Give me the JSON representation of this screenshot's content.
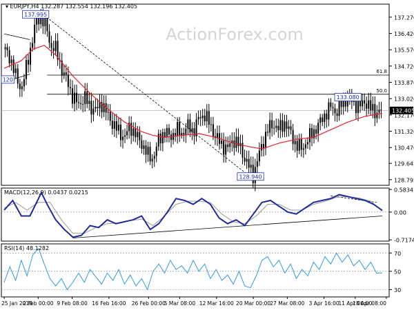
{
  "watermark": "ActionForex.com",
  "chart_data": [
    {
      "type": "candlestick",
      "panel": "price",
      "symbol_label": "EURJPY,H4",
      "ohlc_label": "132.287 132.554 132.196 132.405",
      "last_price": 132.405,
      "ylim": [
        128.5,
        137.95
      ],
      "y_ticks": [
        128.795,
        129.645,
        130.47,
        131.32,
        132.17,
        133.02,
        133.87,
        134.72,
        135.57,
        136.42,
        137.27
      ],
      "y_tick_labels": [
        "128.795",
        "129.645",
        "130.470",
        "131.320",
        "132.170",
        "133.020",
        "133.870",
        "134.720",
        "135.570",
        "136.420",
        "137.270"
      ],
      "x_range": [
        0,
        132
      ],
      "x_ticks": [
        0,
        12,
        25,
        38,
        52,
        63,
        76,
        89,
        101,
        114,
        125
      ],
      "x_tick_labels": [
        "25 Jan 2018",
        "2 Feb 00:00",
        "9 Feb 08:00",
        "16 Feb 16:00",
        "26 Feb 00:00",
        "5 Mar 08:00",
        "12 Mar 16:00",
        "20 Mar 00:00",
        "27 Mar 08:00",
        "3 Apr 16:00",
        "11 Apr 00:00",
        "18 Apr 08:00"
      ],
      "x_tick_positions": [
        1,
        13,
        25,
        38,
        52,
        63,
        76,
        89,
        101,
        114,
        125,
        136
      ],
      "close_path": [
        [
          0,
          135.6
        ],
        [
          2,
          135.2
        ],
        [
          4,
          134.2
        ],
        [
          6,
          133.5
        ],
        [
          8,
          134.8
        ],
        [
          10,
          136.2
        ],
        [
          11,
          137.0
        ],
        [
          13,
          137.3
        ],
        [
          15,
          136.6
        ],
        [
          16,
          135.8
        ],
        [
          18,
          135.6
        ],
        [
          20,
          134.6
        ],
        [
          22,
          133.9
        ],
        [
          24,
          133.1
        ],
        [
          26,
          132.7
        ],
        [
          28,
          133.1
        ],
        [
          30,
          132.6
        ],
        [
          32,
          132.4
        ],
        [
          34,
          132.8
        ],
        [
          36,
          132.2
        ],
        [
          38,
          131.7
        ],
        [
          40,
          131.3
        ],
        [
          42,
          131.0
        ],
        [
          44,
          131.6
        ],
        [
          46,
          131.1
        ],
        [
          48,
          130.7
        ],
        [
          50,
          130.1
        ],
        [
          52,
          129.9
        ],
        [
          54,
          130.9
        ],
        [
          56,
          131.3
        ],
        [
          58,
          131.0
        ],
        [
          60,
          131.4
        ],
        [
          62,
          131.2
        ],
        [
          64,
          131.6
        ],
        [
          66,
          131.3
        ],
        [
          68,
          132.0
        ],
        [
          70,
          132.2
        ],
        [
          72,
          131.6
        ],
        [
          74,
          131.0
        ],
        [
          76,
          130.6
        ],
        [
          78,
          130.4
        ],
        [
          80,
          130.9
        ],
        [
          82,
          130.6
        ],
        [
          84,
          129.9
        ],
        [
          86,
          129.3
        ],
        [
          87,
          129.0
        ],
        [
          88,
          129.6
        ],
        [
          90,
          130.6
        ],
        [
          92,
          131.4
        ],
        [
          94,
          131.7
        ],
        [
          96,
          131.4
        ],
        [
          98,
          131.8
        ],
        [
          100,
          131.2
        ],
        [
          102,
          130.6
        ],
        [
          104,
          130.4
        ],
        [
          106,
          130.9
        ],
        [
          108,
          131.3
        ],
        [
          110,
          131.7
        ],
        [
          112,
          132.2
        ],
        [
          114,
          132.6
        ],
        [
          116,
          132.3
        ],
        [
          118,
          132.8
        ],
        [
          120,
          133.1
        ],
        [
          122,
          132.8
        ],
        [
          124,
          132.6
        ],
        [
          126,
          132.9
        ],
        [
          128,
          132.5
        ],
        [
          130,
          132.3
        ],
        [
          132,
          132.405
        ]
      ],
      "ma_path": [
        [
          0,
          134.6
        ],
        [
          6,
          135.0
        ],
        [
          10,
          135.6
        ],
        [
          14,
          135.8
        ],
        [
          18,
          135.3
        ],
        [
          24,
          134.2
        ],
        [
          30,
          133.3
        ],
        [
          36,
          132.5
        ],
        [
          42,
          131.8
        ],
        [
          48,
          131.3
        ],
        [
          52,
          131.1
        ],
        [
          56,
          131.0
        ],
        [
          62,
          131.1
        ],
        [
          68,
          131.2
        ],
        [
          74,
          131.0
        ],
        [
          80,
          130.7
        ],
        [
          86,
          130.5
        ],
        [
          90,
          130.4
        ],
        [
          96,
          130.7
        ],
        [
          102,
          130.9
        ],
        [
          108,
          131.0
        ],
        [
          114,
          131.4
        ],
        [
          120,
          131.8
        ],
        [
          126,
          132.1
        ],
        [
          132,
          132.25
        ]
      ],
      "annotations": [
        {
          "label": "137.995",
          "x": 11,
          "y": 137.4
        },
        {
          "label": "128.940",
          "x": 86,
          "y": 128.94
        },
        {
          "label": "133.080",
          "x": 120,
          "y": 133.08
        },
        {
          "label": "120",
          "x": 0,
          "y": 134.0
        }
      ],
      "levels": [
        {
          "label": "61.8",
          "y": 134.25,
          "x_start": 15
        },
        {
          "label": "50.0",
          "y": 133.25,
          "x_start": 15
        }
      ],
      "trendlines": [
        {
          "from": [
            12,
            137.6
          ],
          "to": [
            86,
            128.94
          ],
          "style": "dashed"
        },
        {
          "from": [
            0,
            136.4
          ],
          "to": [
            9,
            136.1
          ],
          "style": "solid"
        },
        {
          "from": [
            0,
            133.9
          ],
          "to": [
            9,
            134.3
          ],
          "style": "solid"
        }
      ]
    },
    {
      "type": "line",
      "panel": "macd",
      "label": "MACD(12,26,9) 0.0437 0.0215",
      "ylim": [
        -0.75,
        0.62
      ],
      "y_ticks": [
        0.5834,
        0.0,
        -0.7174
      ],
      "y_tick_labels": [
        "0.5834",
        "0.00",
        "-0.7174"
      ],
      "series": [
        {
          "values": [
            [
              0,
              0.05
            ],
            [
              3,
              0.3
            ],
            [
              6,
              -0.1
            ],
            [
              9,
              -0.1
            ],
            [
              12,
              0.35
            ],
            [
              13,
              0.5
            ],
            [
              15,
              0.2
            ],
            [
              18,
              -0.2
            ],
            [
              21,
              -0.45
            ],
            [
              24,
              -0.65
            ],
            [
              27,
              -0.6
            ],
            [
              30,
              -0.35
            ],
            [
              33,
              -0.4
            ],
            [
              36,
              -0.2
            ],
            [
              39,
              -0.3
            ],
            [
              42,
              -0.25
            ],
            [
              45,
              -0.2
            ],
            [
              48,
              -0.1
            ],
            [
              51,
              -0.45
            ],
            [
              54,
              -0.3
            ],
            [
              57,
              0.0
            ],
            [
              60,
              0.35
            ],
            [
              63,
              0.3
            ],
            [
              66,
              0.2
            ],
            [
              69,
              0.35
            ],
            [
              72,
              0.2
            ],
            [
              75,
              -0.15
            ],
            [
              78,
              -0.3
            ],
            [
              81,
              -0.2
            ],
            [
              84,
              -0.35
            ],
            [
              87,
              -0.05
            ],
            [
              90,
              0.25
            ],
            [
              93,
              0.3
            ],
            [
              96,
              0.15
            ],
            [
              99,
              0.0
            ],
            [
              102,
              -0.05
            ],
            [
              105,
              0.1
            ],
            [
              108,
              0.25
            ],
            [
              111,
              0.3
            ],
            [
              114,
              0.35
            ],
            [
              117,
              0.45
            ],
            [
              120,
              0.4
            ],
            [
              123,
              0.35
            ],
            [
              126,
              0.3
            ],
            [
              129,
              0.2
            ],
            [
              132,
              0.0437
            ]
          ]
        },
        {
          "values": [
            [
              0,
              0.1
            ],
            [
              4,
              0.25
            ],
            [
              8,
              0.05
            ],
            [
              12,
              0.25
            ],
            [
              16,
              0.25
            ],
            [
              20,
              -0.2
            ],
            [
              24,
              -0.55
            ],
            [
              28,
              -0.55
            ],
            [
              32,
              -0.4
            ],
            [
              36,
              -0.3
            ],
            [
              40,
              -0.28
            ],
            [
              44,
              -0.22
            ],
            [
              48,
              -0.18
            ],
            [
              52,
              -0.35
            ],
            [
              56,
              -0.1
            ],
            [
              60,
              0.2
            ],
            [
              64,
              0.28
            ],
            [
              68,
              0.28
            ],
            [
              72,
              0.25
            ],
            [
              76,
              -0.05
            ],
            [
              80,
              -0.25
            ],
            [
              84,
              -0.3
            ],
            [
              88,
              -0.1
            ],
            [
              92,
              0.2
            ],
            [
              96,
              0.2
            ],
            [
              100,
              0.05
            ],
            [
              104,
              0.05
            ],
            [
              108,
              0.2
            ],
            [
              112,
              0.28
            ],
            [
              116,
              0.38
            ],
            [
              120,
              0.4
            ],
            [
              124,
              0.36
            ],
            [
              128,
              0.28
            ],
            [
              132,
              0.0215
            ]
          ]
        }
      ],
      "trendlines": [
        {
          "from": [
            24,
            -0.67
          ],
          "to": [
            132,
            -0.1
          ]
        },
        {
          "from": [
            114,
            0.42
          ],
          "to": [
            130,
            0.25
          ],
          "style": "dashed"
        }
      ]
    },
    {
      "type": "line",
      "panel": "rsi",
      "label": "RSI(14) 48.1282",
      "ylim": [
        22,
        80
      ],
      "y_ticks": [
        70,
        50,
        30
      ],
      "y_tick_labels": [
        "70",
        "50",
        "30"
      ],
      "series": [
        {
          "values": [
            [
              0,
              38
            ],
            [
              2,
              55
            ],
            [
              4,
              40
            ],
            [
              6,
              62
            ],
            [
              8,
              45
            ],
            [
              10,
              68
            ],
            [
              12,
              75
            ],
            [
              14,
              58
            ],
            [
              16,
              42
            ],
            [
              18,
              34
            ],
            [
              20,
              42
            ],
            [
              22,
              30
            ],
            [
              24,
              38
            ],
            [
              26,
              48
            ],
            [
              28,
              38
            ],
            [
              30,
              52
            ],
            [
              32,
              44
            ],
            [
              34,
              36
            ],
            [
              36,
              48
            ],
            [
              38,
              40
            ],
            [
              40,
              52
            ],
            [
              42,
              36
            ],
            [
              44,
              46
            ],
            [
              46,
              34
            ],
            [
              48,
              42
            ],
            [
              50,
              30
            ],
            [
              52,
              50
            ],
            [
              54,
              58
            ],
            [
              56,
              48
            ],
            [
              58,
              62
            ],
            [
              60,
              52
            ],
            [
              62,
              56
            ],
            [
              64,
              48
            ],
            [
              66,
              62
            ],
            [
              68,
              50
            ],
            [
              70,
              58
            ],
            [
              72,
              42
            ],
            [
              74,
              52
            ],
            [
              76,
              40
            ],
            [
              78,
              46
            ],
            [
              80,
              36
            ],
            [
              82,
              50
            ],
            [
              84,
              34
            ],
            [
              86,
              32
            ],
            [
              88,
              45
            ],
            [
              90,
              62
            ],
            [
              92,
              66
            ],
            [
              94,
              55
            ],
            [
              96,
              62
            ],
            [
              98,
              48
            ],
            [
              100,
              58
            ],
            [
              102,
              42
            ],
            [
              104,
              52
            ],
            [
              106,
              45
            ],
            [
              108,
              60
            ],
            [
              110,
              52
            ],
            [
              112,
              66
            ],
            [
              114,
              58
            ],
            [
              116,
              70
            ],
            [
              118,
              60
            ],
            [
              120,
              68
            ],
            [
              122,
              56
            ],
            [
              124,
              62
            ],
            [
              126,
              52
            ],
            [
              128,
              60
            ],
            [
              130,
              48
            ],
            [
              132,
              48.1282
            ]
          ]
        }
      ]
    }
  ]
}
